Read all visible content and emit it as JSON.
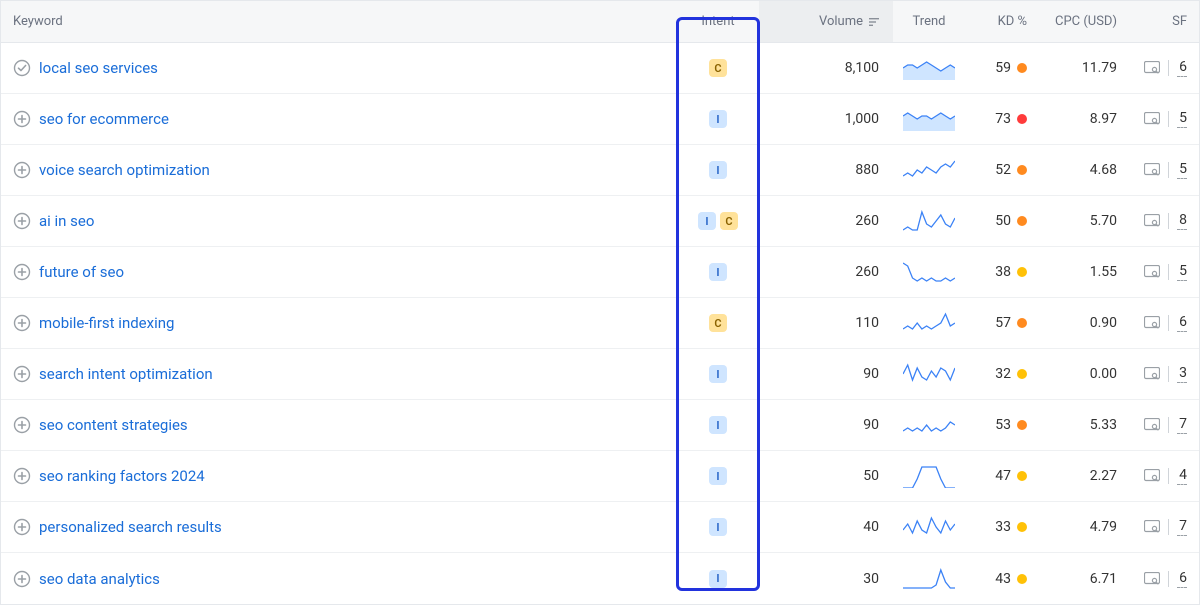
{
  "header": {
    "keyword": "Keyword",
    "intent": "Intent",
    "volume": "Volume",
    "trend": "Trend",
    "kd": "KD %",
    "cpc": "CPC (USD)",
    "sf": "SF"
  },
  "rows": [
    {
      "icon": "check",
      "keyword": "local seo services",
      "intents": [
        "C"
      ],
      "volume": "8,100",
      "trend": [
        4,
        5,
        5,
        4,
        5,
        6,
        5,
        4,
        3,
        4,
        5,
        4
      ],
      "trend_fill": true,
      "kd": "59",
      "kd_color": "#ff8a1f",
      "cpc": "11.79",
      "sf": "6"
    },
    {
      "icon": "plus",
      "keyword": "seo for ecommerce",
      "intents": [
        "I"
      ],
      "volume": "1,000",
      "trend": [
        5,
        6,
        5,
        4,
        5,
        5,
        4,
        5,
        6,
        5,
        4,
        5
      ],
      "trend_fill": true,
      "kd": "73",
      "kd_color": "#ff3b3b",
      "cpc": "8.97",
      "sf": "5"
    },
    {
      "icon": "plus",
      "keyword": "voice search optimization",
      "intents": [
        "I"
      ],
      "volume": "880",
      "trend": [
        2,
        3,
        2,
        4,
        3,
        5,
        4,
        3,
        5,
        6,
        5,
        7
      ],
      "trend_fill": false,
      "kd": "52",
      "kd_color": "#ff8a1f",
      "cpc": "4.68",
      "sf": "5"
    },
    {
      "icon": "plus",
      "keyword": "ai in seo",
      "intents": [
        "I",
        "C"
      ],
      "volume": "260",
      "trend": [
        1,
        2,
        1,
        1,
        7,
        3,
        2,
        4,
        6,
        3,
        2,
        5
      ],
      "trend_fill": false,
      "kd": "50",
      "kd_color": "#ff8a1f",
      "cpc": "5.70",
      "sf": "8"
    },
    {
      "icon": "plus",
      "keyword": "future of seo",
      "intents": [
        "I"
      ],
      "volume": "260",
      "trend": [
        7,
        6,
        2,
        1,
        2,
        1,
        2,
        1,
        1,
        2,
        1,
        2
      ],
      "trend_fill": false,
      "kd": "38",
      "kd_color": "#ffc107",
      "cpc": "1.55",
      "sf": "5"
    },
    {
      "icon": "plus",
      "keyword": "mobile-first indexing",
      "intents": [
        "C"
      ],
      "volume": "110",
      "trend": [
        2,
        3,
        2,
        4,
        2,
        3,
        2,
        3,
        4,
        7,
        3,
        4
      ],
      "trend_fill": false,
      "kd": "57",
      "kd_color": "#ff8a1f",
      "cpc": "0.90",
      "sf": "6"
    },
    {
      "icon": "plus",
      "keyword": "search intent optimization",
      "intents": [
        "I"
      ],
      "volume": "90",
      "trend": [
        4,
        7,
        2,
        6,
        3,
        2,
        5,
        3,
        6,
        5,
        2,
        6
      ],
      "trend_fill": false,
      "kd": "32",
      "kd_color": "#ffc107",
      "cpc": "0.00",
      "sf": "3"
    },
    {
      "icon": "plus",
      "keyword": "seo content strategies",
      "intents": [
        "I"
      ],
      "volume": "90",
      "trend": [
        2,
        3,
        2,
        3,
        2,
        4,
        2,
        3,
        2,
        3,
        5,
        4
      ],
      "trend_fill": false,
      "kd": "53",
      "kd_color": "#ff8a1f",
      "cpc": "5.33",
      "sf": "7"
    },
    {
      "icon": "plus",
      "keyword": "seo ranking factors 2024",
      "intents": [
        "I"
      ],
      "volume": "50",
      "trend": [
        0,
        0,
        0,
        3,
        7,
        7,
        7,
        7,
        3,
        0,
        0,
        0
      ],
      "trend_fill": false,
      "kd": "47",
      "kd_color": "#ffc107",
      "cpc": "2.27",
      "sf": "4"
    },
    {
      "icon": "plus",
      "keyword": "personalized search results",
      "intents": [
        "I"
      ],
      "volume": "40",
      "trend": [
        3,
        5,
        2,
        6,
        3,
        2,
        7,
        4,
        2,
        6,
        3,
        5
      ],
      "trend_fill": false,
      "kd": "33",
      "kd_color": "#ffc107",
      "cpc": "4.79",
      "sf": "7"
    },
    {
      "icon": "plus",
      "keyword": "seo data analytics",
      "intents": [
        "I"
      ],
      "volume": "30",
      "trend": [
        1,
        1,
        1,
        1,
        1,
        1,
        1,
        2,
        7,
        3,
        1,
        1
      ],
      "trend_fill": false,
      "kd": "43",
      "kd_color": "#ffc107",
      "cpc": "6.71",
      "sf": "6"
    }
  ]
}
